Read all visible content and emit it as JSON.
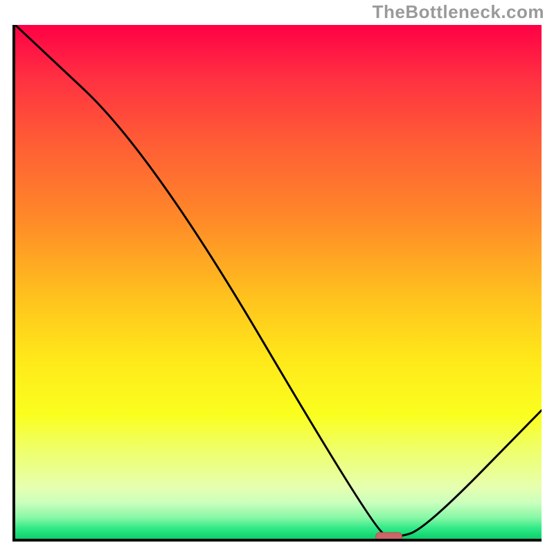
{
  "watermark": "TheBottleneck.com",
  "colors": {
    "gradient_top": "#ff0045",
    "gradient_mid_upper": "#ff8a28",
    "gradient_mid": "#ffe81a",
    "gradient_lower": "#e6ffb0",
    "gradient_bottom": "#0ecf6b",
    "axis": "#000000",
    "curve": "#000000",
    "marker_fill": "#cc6666",
    "marker_stroke": "#b34d4d"
  },
  "chart_data": {
    "type": "line",
    "title": "",
    "xlabel": "",
    "ylabel": "",
    "xlim": [
      0,
      100
    ],
    "ylim": [
      0,
      100
    ],
    "grid": false,
    "series": [
      {
        "name": "curve",
        "x": [
          0,
          26,
          68,
          72,
          78,
          100
        ],
        "y": [
          100,
          75,
          2,
          0,
          2,
          25
        ]
      }
    ],
    "marker": {
      "x_center": 71,
      "y": 0,
      "width_pct": 5
    },
    "notes": "x and y are in percent of plot area; no numeric axis labels are shown in the source image, so values are relative estimates read from the plotted curve."
  }
}
